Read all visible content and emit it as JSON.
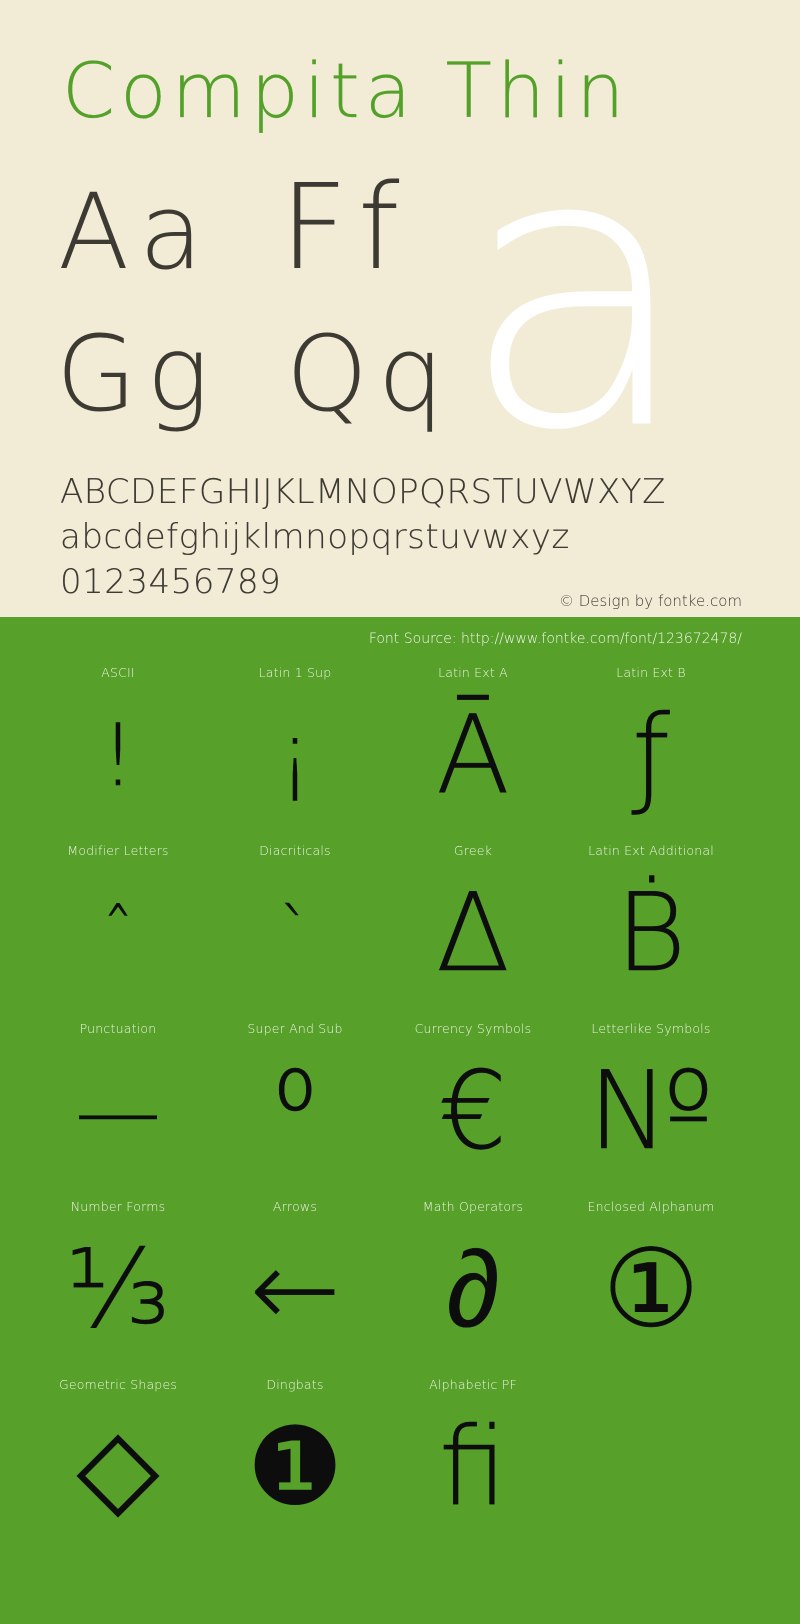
{
  "page": {
    "background_cream": "#f2ecd7",
    "background_green": "#57a02a",
    "accent_green": "#54a129",
    "ink": "#3d3a33"
  },
  "header": {
    "font_title": "Compita Thin"
  },
  "showcase": {
    "pairs": [
      {
        "glyphs": "Aa"
      },
      {
        "glyphs": "Ff"
      },
      {
        "glyphs": "Gg"
      },
      {
        "glyphs": "Qq"
      }
    ],
    "giant_glyph": "a"
  },
  "alphabet": {
    "uppercase": "ABCDEFGHIJKLMNOPQRSTUVWXYZ",
    "lowercase": "abcdefghijklmnopqrstuvwxyz",
    "digits": "0123456789"
  },
  "credits": {
    "design": "© Design by fontke.com",
    "font_source": "Font Source: http://www.fontke.com/font/123672478/"
  },
  "coverage": {
    "rows": [
      {
        "cells": [
          {
            "label": "ASCII",
            "glyph": "!",
            "size": "medium"
          },
          {
            "label": "Latin 1 Sup",
            "glyph": "¡",
            "size": "medium"
          },
          {
            "label": "Latin Ext A",
            "glyph": "Ā",
            "size": "large"
          },
          {
            "label": "Latin Ext B",
            "glyph": "ƒ",
            "size": "large"
          }
        ]
      },
      {
        "cells": [
          {
            "label": "Modifier Letters",
            "glyph": "ˆ",
            "size": "small"
          },
          {
            "label": "Diacriticals",
            "glyph": "ˋ",
            "size": "small"
          },
          {
            "label": "Greek",
            "glyph": "Δ",
            "size": "large"
          },
          {
            "label": "Latin Ext Additional",
            "glyph": "Ḃ",
            "size": "large"
          }
        ]
      },
      {
        "cells": [
          {
            "label": "Punctuation",
            "glyph": "—",
            "size": "medium"
          },
          {
            "label": "Super And Sub",
            "glyph": "⁰",
            "size": "large"
          },
          {
            "label": "Currency Symbols",
            "glyph": "€",
            "size": "large"
          },
          {
            "label": "Letterlike Symbols",
            "glyph": "№",
            "size": "large"
          }
        ]
      },
      {
        "cells": [
          {
            "label": "Number Forms",
            "glyph": "⅓",
            "size": "large"
          },
          {
            "label": "Arrows",
            "glyph": "←",
            "size": "large"
          },
          {
            "label": "Math Operators",
            "glyph": "∂",
            "size": "large"
          },
          {
            "label": "Enclosed Alphanum",
            "glyph": "①",
            "size": "large"
          }
        ]
      },
      {
        "cells": [
          {
            "label": "Geometric Shapes",
            "glyph": "◇",
            "size": "large"
          },
          {
            "label": "Dingbats",
            "glyph": "❶",
            "size": "large"
          },
          {
            "label": "Alphabetic PF",
            "glyph": "ﬁ",
            "size": "large"
          }
        ]
      }
    ]
  }
}
